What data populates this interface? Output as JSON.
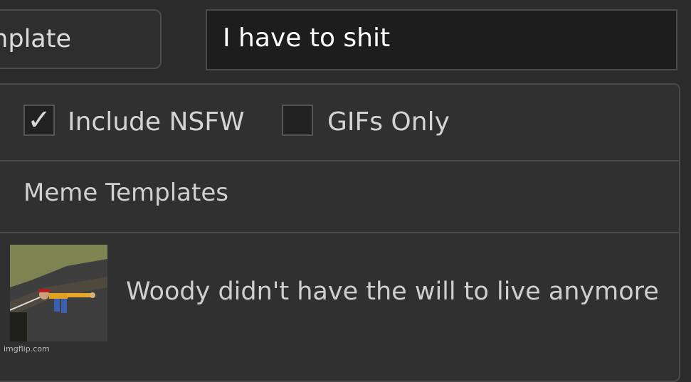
{
  "toolbar": {
    "template_button_label": "nplate",
    "search_value": "I have to shit"
  },
  "filters": {
    "nsfw": {
      "label": "Include NSFW",
      "checked": true
    },
    "gifs": {
      "label": "GIFs Only",
      "checked": false
    }
  },
  "section": {
    "title": "Meme Templates"
  },
  "results": [
    {
      "title": "Woody didn't have the will to live anymore"
    }
  ],
  "watermark": "imgflip.com"
}
